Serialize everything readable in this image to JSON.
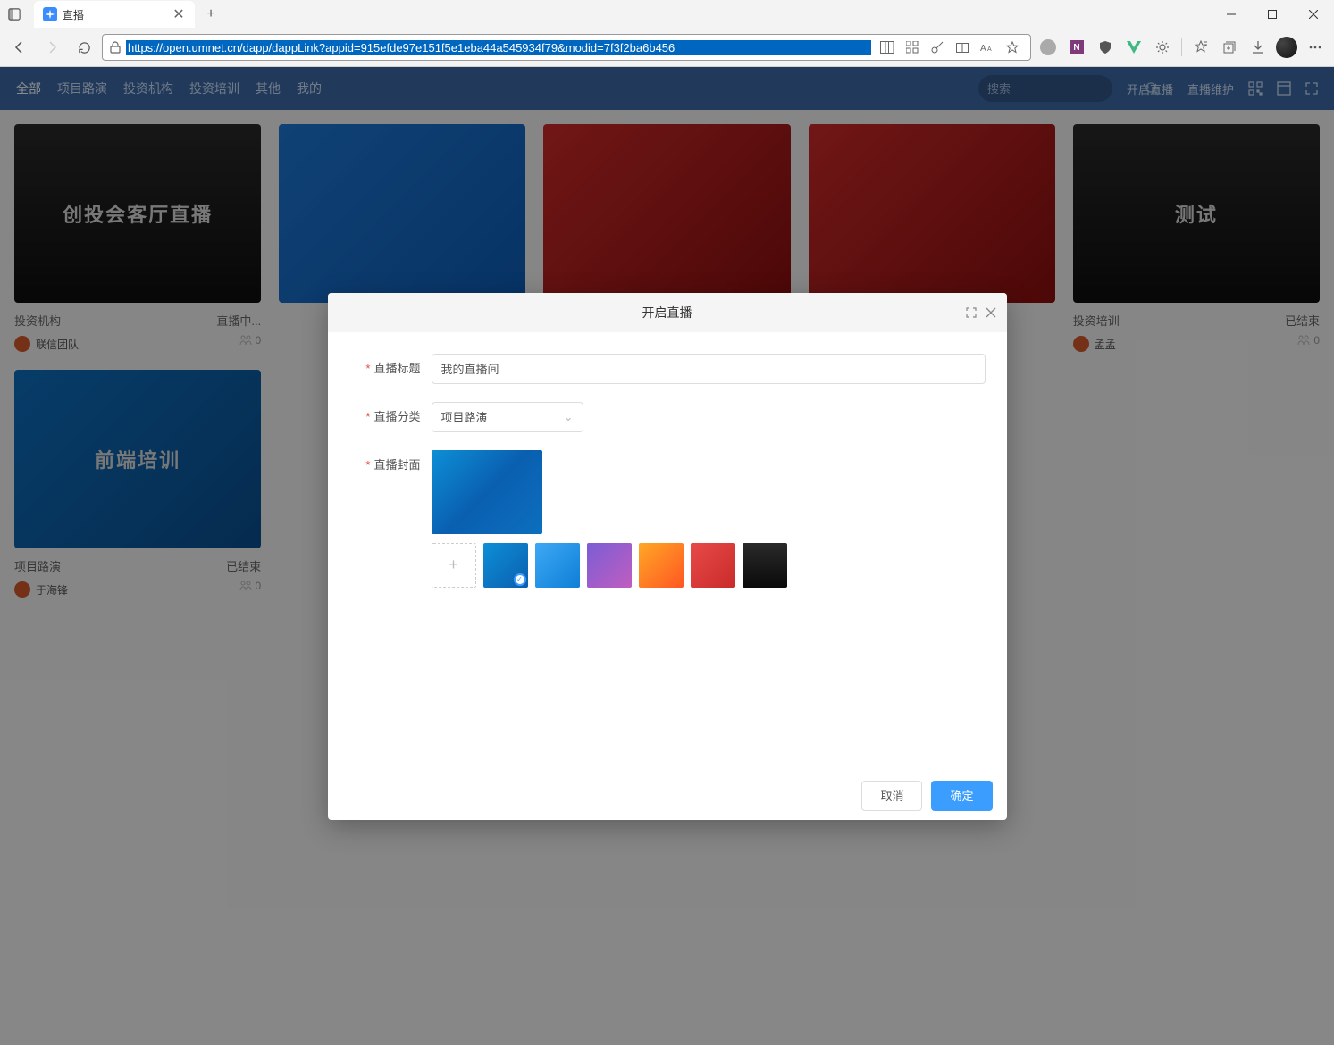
{
  "browser": {
    "tab_title": "直播",
    "url": "https://open.umnet.cn/dapp/dappLink?appid=915efde97e151f5e1eba44a545934f79&modid=7f3f2ba6b456"
  },
  "header": {
    "nav": [
      "全部",
      "项目路演",
      "投资机构",
      "投资培训",
      "其他",
      "我的"
    ],
    "search_placeholder": "搜索",
    "start_live": "开启直播",
    "live_maintain": "直播维护"
  },
  "cards": [
    {
      "title": "创投会客厅直播",
      "category": "投资机构",
      "status": "直播中...",
      "author": "联信团队",
      "viewers": "0",
      "style": "black"
    },
    {
      "title": "",
      "category": "",
      "status": "",
      "author": "",
      "viewers": "",
      "style": "blue"
    },
    {
      "title": "",
      "category": "",
      "status": "",
      "author": "",
      "viewers": "",
      "style": "red"
    },
    {
      "title": "",
      "category": "",
      "status": "",
      "author": "",
      "viewers": "",
      "style": "red"
    },
    {
      "title": "测试",
      "category": "投资培训",
      "status": "已结束",
      "author": "孟孟",
      "viewers": "0",
      "style": "black"
    },
    {
      "title": "前端培训",
      "category": "项目路演",
      "status": "已结束",
      "author": "于海锋",
      "viewers": "0",
      "style": "bluegeo"
    }
  ],
  "modal": {
    "title": "开启直播",
    "fields": {
      "title_label": "直播标题",
      "title_value": "我的直播间",
      "category_label": "直播分类",
      "category_value": "项目路演",
      "cover_label": "直播封面"
    },
    "cancel": "取消",
    "confirm": "确定"
  }
}
